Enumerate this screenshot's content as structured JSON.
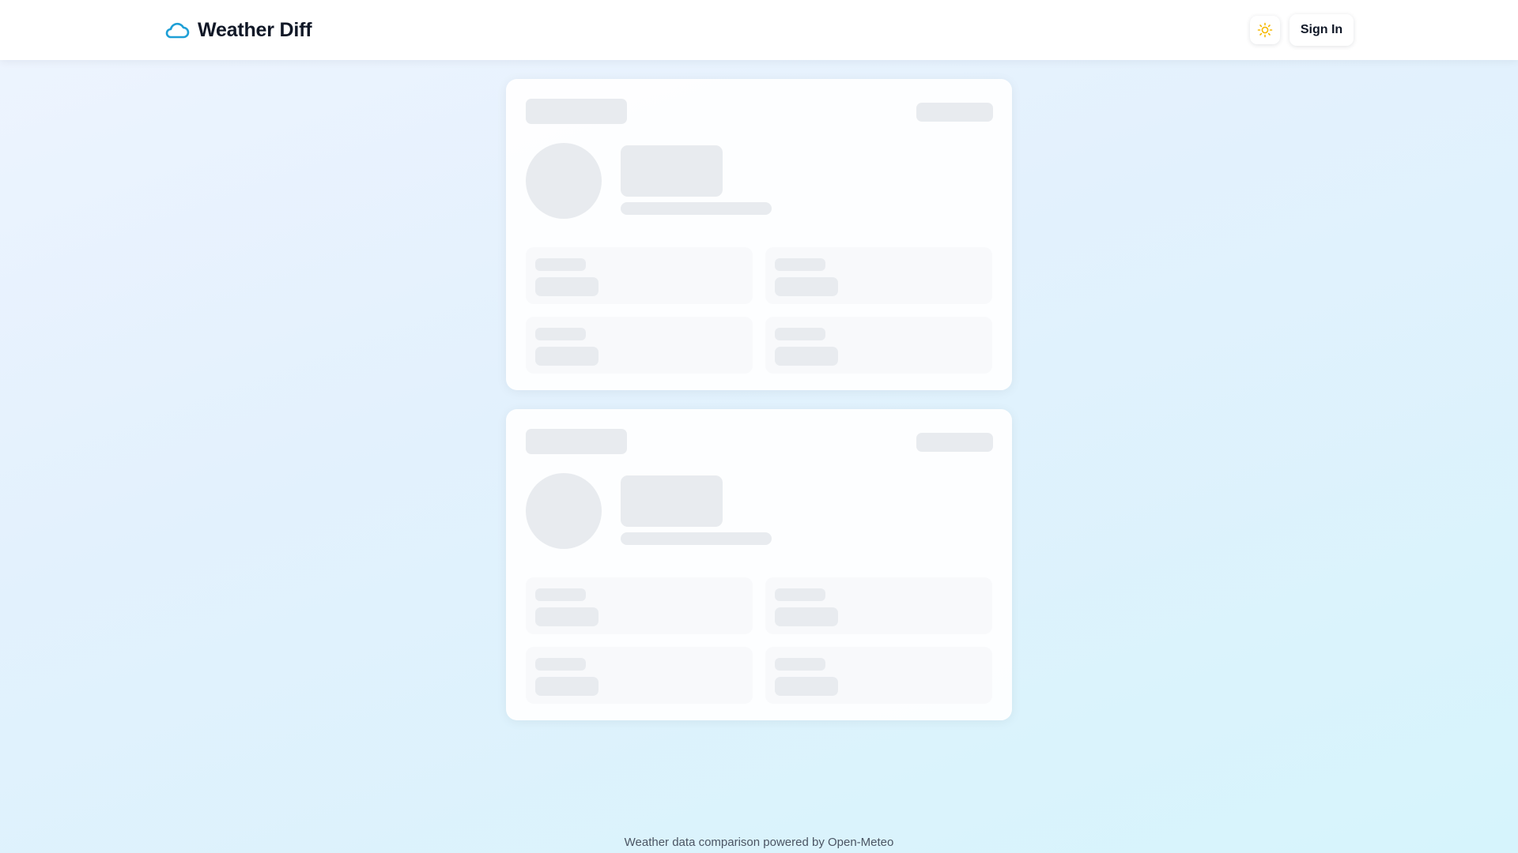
{
  "header": {
    "title": "Weather Diff",
    "logo_icon": "cloud-icon",
    "theme_toggle_icon": "sun-icon",
    "sign_in_label": "Sign In"
  },
  "colors": {
    "brand_accent": "#1e9fd6",
    "sun_icon": "#f5b800",
    "skeleton": "#e8ebef"
  },
  "main": {
    "state": "loading",
    "cards": [
      {
        "metric_tiles": 4
      },
      {
        "metric_tiles": 4
      }
    ]
  },
  "footer": {
    "text": "Weather data comparison powered by Open-Meteo"
  }
}
